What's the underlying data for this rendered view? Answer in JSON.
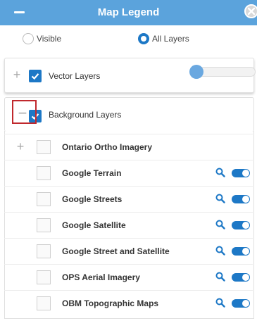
{
  "header": {
    "title": "Map Legend",
    "minimize_icon": "minus-icon",
    "close_icon": "close-circle-icon"
  },
  "filter": {
    "options": [
      {
        "label": "Visible",
        "selected": false
      },
      {
        "label": "All Layers",
        "selected": true
      }
    ]
  },
  "vector": {
    "label": "Vector Layers",
    "checked": true,
    "opacity": 0.0
  },
  "background": {
    "label": "Background Layers",
    "checked": true,
    "expanded": true
  },
  "layers": [
    {
      "name": "Ontario Ortho Imagery",
      "expandable": true,
      "checked": false,
      "tools": false
    },
    {
      "name": "Google Terrain",
      "expandable": false,
      "checked": false,
      "tools": true
    },
    {
      "name": "Google Streets",
      "expandable": false,
      "checked": false,
      "tools": true
    },
    {
      "name": "Google Satellite",
      "expandable": false,
      "checked": false,
      "tools": true
    },
    {
      "name": "Google Street and Satellite",
      "expandable": false,
      "checked": false,
      "tools": true
    },
    {
      "name": "OPS Aerial Imagery",
      "expandable": false,
      "checked": false,
      "tools": true
    },
    {
      "name": "OBM Topographic Maps",
      "expandable": false,
      "checked": false,
      "tools": true
    }
  ],
  "colors": {
    "header": "#5ba3dc",
    "accent": "#1d78c6",
    "highlight": "#c0282d"
  }
}
